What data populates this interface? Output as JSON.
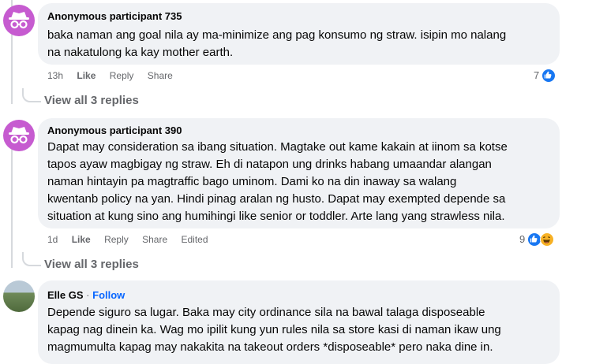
{
  "comments": [
    {
      "author": "Anonymous participant 735",
      "text": "baka naman ang goal nila ay ma-minimize ang pag konsumo ng straw. isipin mo nalang\nna nakatulong ka kay mother earth.",
      "time": "13h",
      "like_label": "Like",
      "reply_label": "Reply",
      "share_label": "Share",
      "reaction_count": "7",
      "view_replies": "View all 3 replies"
    },
    {
      "author": "Anonymous participant 390",
      "text": "Dapat may consideration sa ibang situation. Magtake out kame kakain at iinom sa kotse\ntapos ayaw magbigay ng straw. Eh di natapon ung drinks habang umaandar alangan\nnaman hintayin pa magtraffic bago uminom. Dami ko na din inaway sa walang\nkwentanb policy na yan. Hindi pinag aralan ng husto. Dapat may exempted depende sa\nsituation at kung sino ang humihingi like senior or toddler. Arte lang yang strawless nila.",
      "time": "1d",
      "like_label": "Like",
      "reply_label": "Reply",
      "share_label": "Share",
      "edited_label": "Edited",
      "reaction_count": "9",
      "view_replies": "View all 3 replies"
    },
    {
      "author": "Elle GS",
      "separator": "·",
      "follow_label": "Follow",
      "text": "Depende siguro sa lugar. Baka may city ordinance sila na bawal talaga disposeable\nkapag nag dinein ka. Wag mo ipilit kung yun rules nila sa store kasi di naman ikaw ung\nmagmumulta kapag may nakakita na takeout orders *disposeable* pero naka dine in."
    }
  ],
  "colors": {
    "bubble_bg": "#f0f2f5",
    "secondary_text": "#65676b",
    "accent": "#0866ff",
    "anon_avatar": "#c65bd0",
    "like_blue": "#1877f2",
    "haha_yellow": "#f7b125"
  },
  "icons": [
    "anonymous-avatar-icon",
    "like-reaction-icon",
    "haha-reaction-icon"
  ]
}
